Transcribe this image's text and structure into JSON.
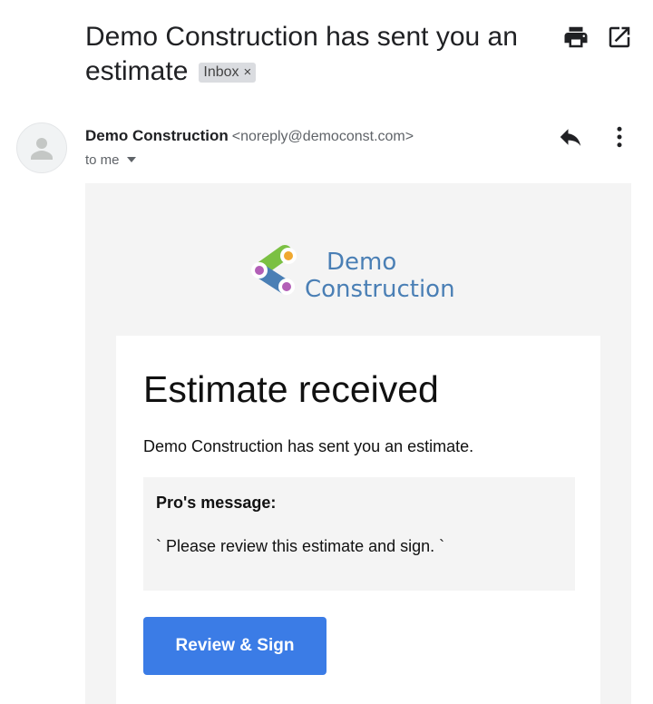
{
  "email": {
    "subject": "Demo Construction has sent you an estimate",
    "label_chip": "Inbox",
    "label_chip_remove": "×",
    "sender": {
      "name": "Demo Construction",
      "email": "<noreply@democonst.com>",
      "recipient": "to me"
    },
    "actions": {
      "print_icon": "printer-icon",
      "popout_icon": "open-in-new-window-icon",
      "reply_icon": "reply-icon",
      "more_icon": "more-vertical-icon"
    }
  },
  "body": {
    "logo": {
      "line1": "Demo",
      "line2": "Construction"
    },
    "title": "Estimate received",
    "intro": "Demo Construction has sent you an estimate.",
    "message_label": "Pro's message:",
    "message_text": "` Please review this estimate and sign. `",
    "cta_label": "Review & Sign"
  },
  "colors": {
    "cta": "#3b7ce6",
    "logo_text": "#4a7fb5",
    "body_bg": "#f4f4f4",
    "chip_bg": "#dadce0"
  }
}
